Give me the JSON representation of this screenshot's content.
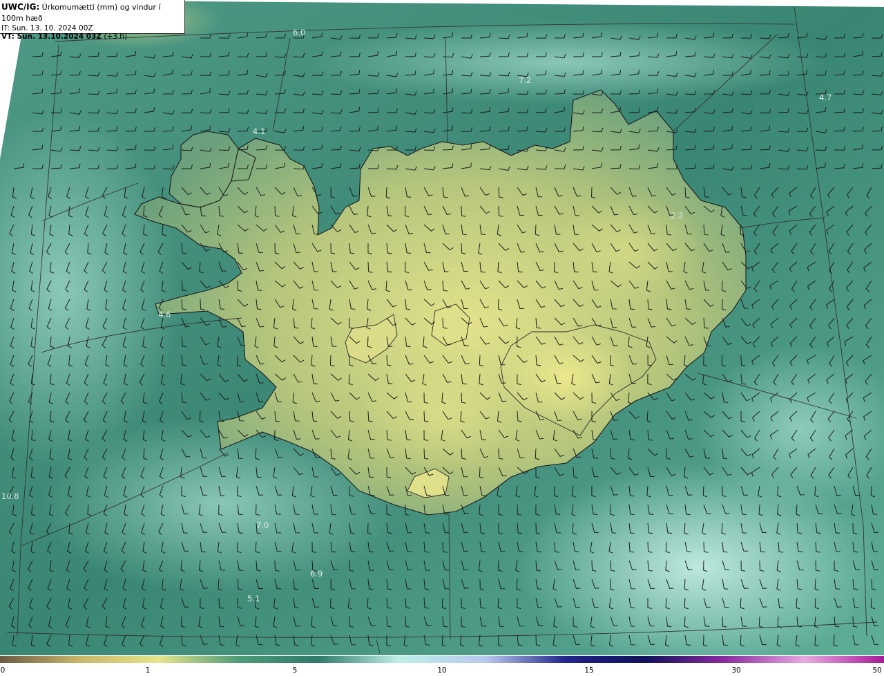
{
  "header": {
    "product_label": "UWC/IG:",
    "product_desc": "Úrkomumætti (mm) og vindur í 100m hæð",
    "it_line": "IT: Sun. 13. 10. 2024 00Z",
    "vt_label": "VT: Sun. 13.10.2024 03Z",
    "vt_offset": "(+3 h)"
  },
  "map_labels": [
    {
      "text": "6.0"
    },
    {
      "text": "7.2"
    },
    {
      "text": "4.7"
    },
    {
      "text": "4.1"
    },
    {
      "text": "2.2"
    },
    {
      "text": "4.6"
    },
    {
      "text": "7.0"
    },
    {
      "text": "6.9"
    },
    {
      "text": "5.1"
    },
    {
      "text": "10.8"
    }
  ],
  "colorbar": {
    "ticks": [
      "0",
      "1",
      "5",
      "10",
      "15",
      "30",
      "50"
    ],
    "colors": [
      "#6b5a44",
      "#c9b66a",
      "#e6e48a",
      "#4f9a78",
      "#2e7a6a",
      "#bfeee6",
      "#b8c8ee",
      "#22248a",
      "#10105a",
      "#8a2aa0",
      "#e8a8e0",
      "#a81a9a"
    ]
  },
  "colors": {
    "sea": "#3f8878",
    "land": "#b9c87e",
    "coast": "#1a1a1a"
  }
}
